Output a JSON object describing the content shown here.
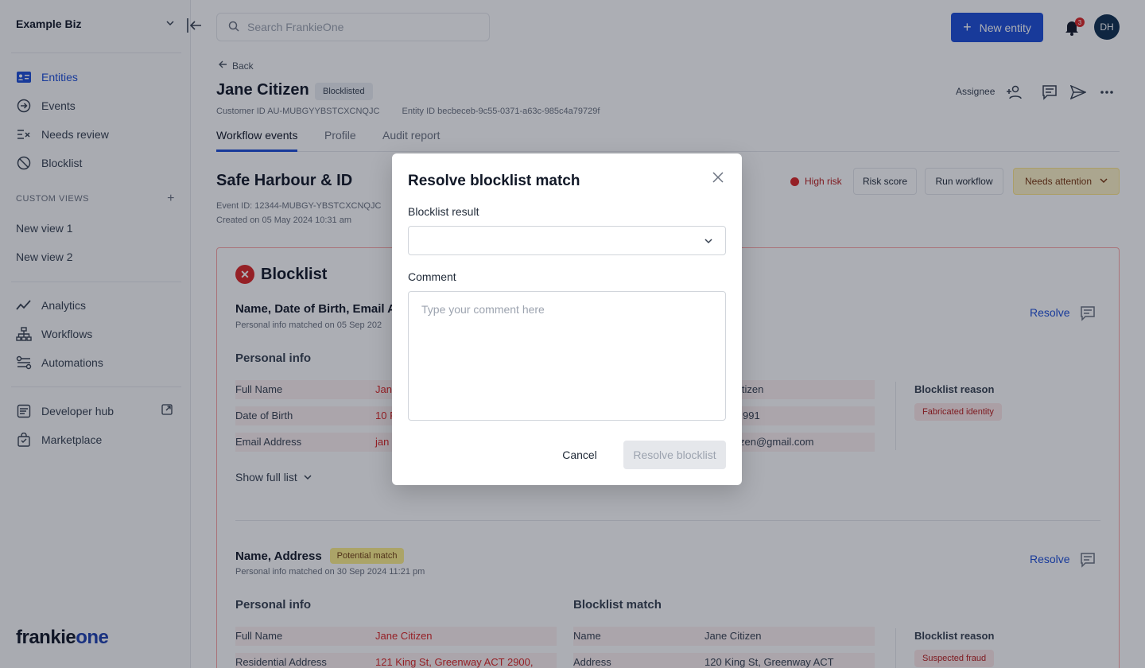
{
  "org": {
    "name": "Example Biz"
  },
  "sidebar": {
    "nav": [
      {
        "label": "Entities",
        "icon": "id-card-icon",
        "active": true
      },
      {
        "label": "Events",
        "icon": "arrow-circle-icon"
      },
      {
        "label": "Needs review",
        "icon": "list-check-icon"
      },
      {
        "label": "Blocklist",
        "icon": "block-icon"
      }
    ],
    "custom_views_label": "CUSTOM VIEWS",
    "views": [
      {
        "label": "New view 1"
      },
      {
        "label": "New view 2"
      }
    ],
    "tools": [
      {
        "label": "Analytics",
        "icon": "analytics-icon"
      },
      {
        "label": "Workflows",
        "icon": "workflow-icon"
      },
      {
        "label": "Automations",
        "icon": "automations-icon"
      }
    ],
    "links": [
      {
        "label": "Developer hub",
        "icon": "code-icon"
      },
      {
        "label": "Marketplace",
        "icon": "bag-icon"
      }
    ],
    "logo": {
      "part1": "frankie",
      "part2": "one"
    }
  },
  "topbar": {
    "search_placeholder": "Search FrankieOne",
    "new_entity_label": "New entity",
    "notification_count": "3",
    "avatar_initials": "DH"
  },
  "header": {
    "back_label": "Back",
    "entity_name": "Jane Citizen",
    "status": "Blocklisted",
    "customer_id_label": "Customer ID",
    "customer_id": "AU-MUBGYYBSTCXCNQJC",
    "entity_id_label": "Entity ID",
    "entity_id": "becbeceb-9c55-0371-a63c-985c4a79729f",
    "assignee_label": "Assignee",
    "tabs": [
      "Workflow events",
      "Profile",
      "Audit report"
    ]
  },
  "event": {
    "title": "Safe Harbour & ID",
    "event_id": "Event ID: 12344-MUBGY-YBSTCXCNQJC",
    "created": "Created on 05 May 2024 10:31 am",
    "risk_label": "High risk",
    "risk_score_label": "Risk score",
    "run_workflow_label": "Run workflow",
    "status_label": "Needs attention"
  },
  "blocklist": {
    "title": "Blocklist",
    "resolve_label": "Resolve",
    "personal_info_label": "Personal info",
    "blocklist_match_label": "Blocklist match",
    "blocklist_reason_label": "Blocklist reason",
    "show_full_list_label": "Show full list",
    "match1": {
      "title": "Name, Date of Birth, Email A",
      "subtitle": "Personal info matched on 05 Sep 202",
      "rows": [
        {
          "label": "Full Name",
          "value": "Jan",
          "match": "itizen"
        },
        {
          "label": "Date of Birth",
          "value": "10 F",
          "match": "991"
        },
        {
          "label": "Email Address",
          "value": "jan",
          "match": "zen@gmail.com"
        }
      ],
      "reason": "Fabricated identity"
    },
    "match2": {
      "title": "Name, Address",
      "badge": "Potential match",
      "subtitle": "Personal info matched on 30 Sep 2024 11:21 pm",
      "rows": [
        {
          "label": "Full Name",
          "value": "Jane Citizen",
          "match_label": "Name",
          "match": "Jane Citizen"
        },
        {
          "label": "Residential Address",
          "value": "121 King St, Greenway ACT 2900,",
          "match_label": "Address",
          "match": "120 King St, Greenway ACT"
        }
      ],
      "reason": "Suspected fraud"
    }
  },
  "modal": {
    "title": "Resolve blocklist match",
    "result_label": "Blocklist result",
    "result_value": "",
    "comment_label": "Comment",
    "comment_placeholder": "Type your comment here",
    "cancel_label": "Cancel",
    "submit_label": "Resolve blocklist"
  },
  "colors": {
    "accent": "#1d4ed8",
    "danger": "#dc2626",
    "warning_bg": "#fef3c7",
    "overlay": "rgba(17,24,39,0.35)"
  }
}
